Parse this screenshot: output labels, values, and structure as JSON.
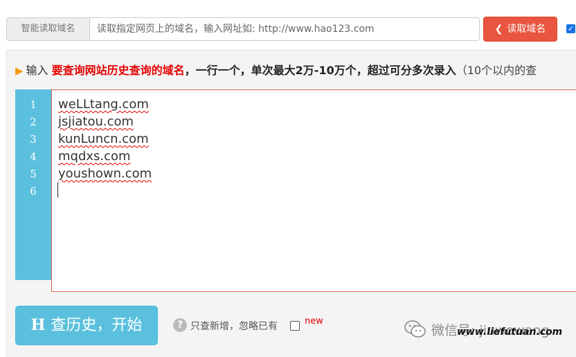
{
  "header": {
    "addon_label": "智能读取域名",
    "url_placeholder": "读取指定网页上的域名，输入网址如: http://www.hao123.com",
    "url_value": "",
    "read_button": "读取域名",
    "read_button_icon": "chevron-left-icon",
    "checkbox_checked": true
  },
  "instruction": {
    "prefix": "输入",
    "highlight": "要查询网站历史查询的域名",
    "bold_text": "，一行一个，单次最大2万-10万个，超过可分多次录入",
    "trailing": "（10个以内的查"
  },
  "editor": {
    "line_numbers": [
      "1",
      "2",
      "3",
      "4",
      "5",
      "6"
    ],
    "lines": [
      " weLLtang.com",
      "jsjiatou.com",
      "kunLuncn.com",
      "mqdxs.com",
      "youshown.com",
      ""
    ]
  },
  "actions": {
    "start_icon_letter": "H",
    "start_label": "查历史，开始",
    "only_new_label": "只查新增，忽略已有",
    "new_tag": "new",
    "help_icon": "?"
  },
  "watermark": {
    "wechat_text": "微信号: jiuwowang",
    "site_text": "www.liefutuan.com"
  },
  "colors": {
    "accent_blue": "#5bc0de",
    "danger_red": "#e9553e",
    "highlight_red": "#e60000",
    "arrow_orange": "#f39c12"
  }
}
